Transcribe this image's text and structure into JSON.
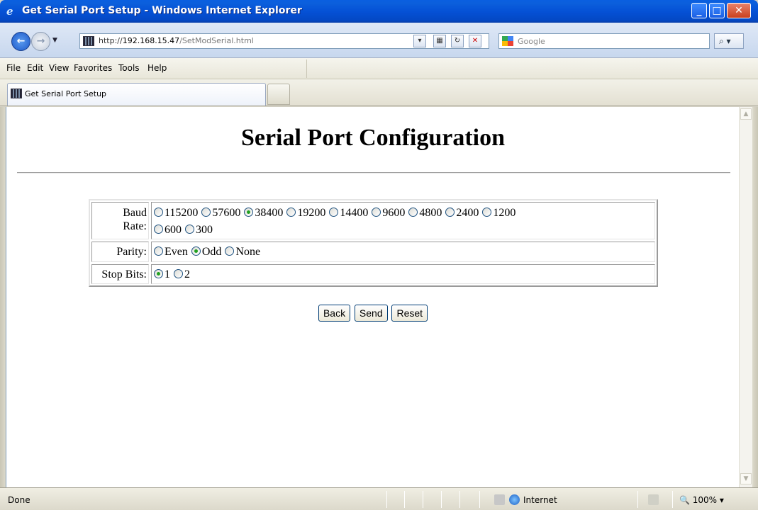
{
  "window": {
    "title": "Get Serial Port Setup - Windows Internet Explorer",
    "buttons": {
      "minimize": "_",
      "maximize": "□",
      "close": "✕"
    }
  },
  "address": {
    "url_prefix": "http://",
    "url_host": "192.168.15.47",
    "url_path": "/SetModSerial.html",
    "search_placeholder": "Google"
  },
  "menu": [
    "File",
    "Edit",
    "View",
    "Favorites",
    "Tools",
    "Help"
  ],
  "tab": {
    "label": "Get Serial Port Setup"
  },
  "page": {
    "title": "Serial Port Configuration",
    "baud_label_1": "Baud",
    "baud_label_2": "Rate:",
    "baud_options": [
      "115200",
      "57600",
      "38400",
      "19200",
      "14400",
      "9600",
      "4800",
      "2400",
      "1200",
      "600",
      "300"
    ],
    "baud_selected": "38400",
    "parity_label": "Parity:",
    "parity_options": [
      "Even",
      "Odd",
      "None"
    ],
    "parity_selected": "Odd",
    "stop_label": "Stop Bits:",
    "stop_options": [
      "1",
      "2"
    ],
    "stop_selected": "1",
    "buttons": {
      "back": "Back",
      "send": "Send",
      "reset": "Reset"
    }
  },
  "status": {
    "text": "Done",
    "zone": "Internet",
    "zoom": "100%"
  },
  "colors": {
    "titlebar": "#0551d6",
    "radio_dot": "#21a121",
    "button_border": "#003c74"
  }
}
